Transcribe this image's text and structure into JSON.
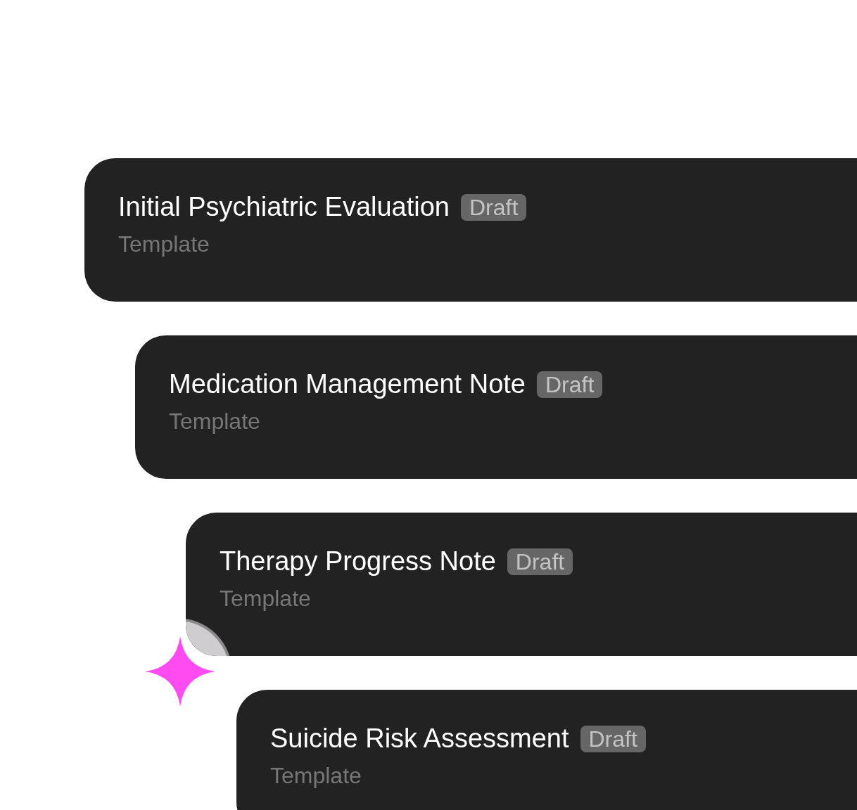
{
  "cards": [
    {
      "title": "Initial Psychiatric Evaluation",
      "tag": "Draft",
      "subtitle": "Template"
    },
    {
      "title": "Medication Management Note",
      "tag": "Draft",
      "subtitle": "Template"
    },
    {
      "title": "Therapy Progress Note",
      "tag": "Draft",
      "subtitle": "Template"
    },
    {
      "title": "Suicide Risk Assessment",
      "tag": "Draft",
      "subtitle": "Template"
    }
  ]
}
